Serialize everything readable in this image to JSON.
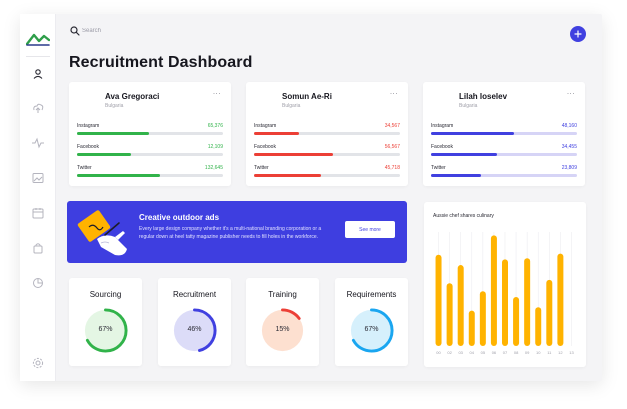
{
  "search": {
    "placeholder": "Search"
  },
  "page": {
    "title": "Recruitment Dashboard"
  },
  "colors": {
    "accent": "#4040e0",
    "green": "#31b34a",
    "red": "#ec3f36",
    "purple": "#4040e0",
    "orange": "#ffb300",
    "logo_green": "#2e9e4a",
    "logo_blue": "#2a3a8c"
  },
  "sidebar": {
    "logo": "brand-logo",
    "items": [
      {
        "icon": "user-icon",
        "active": true
      },
      {
        "icon": "upload-icon",
        "active": false
      },
      {
        "icon": "activity-icon",
        "active": false
      },
      {
        "icon": "image-icon",
        "active": false
      },
      {
        "icon": "calendar-icon",
        "active": false
      },
      {
        "icon": "bag-icon",
        "active": false
      },
      {
        "icon": "pie-chart-icon",
        "active": false
      },
      {
        "icon": "settings-icon",
        "active": false
      }
    ]
  },
  "profiles": [
    {
      "name": "Ava Gregoraci",
      "location": "Bulgaria",
      "menu": "...",
      "color": "#31b34a",
      "track": "#e2e4e8",
      "stats": [
        {
          "label": "Instagram",
          "value": "65,376",
          "fraction": 0.49
        },
        {
          "label": "Facebook",
          "value": "12,109",
          "fraction": 0.37
        },
        {
          "label": "Twitter",
          "value": "132,645",
          "fraction": 0.57
        }
      ]
    },
    {
      "name": "Somun Ae-Ri",
      "location": "Bulgaria",
      "menu": "...",
      "color": "#ec3f36",
      "track": "#e2e4e8",
      "stats": [
        {
          "label": "Instagram",
          "value": "34,567",
          "fraction": 0.31
        },
        {
          "label": "Facebook",
          "value": "56,567",
          "fraction": 0.54
        },
        {
          "label": "Twitter",
          "value": "45,718",
          "fraction": 0.46
        }
      ]
    },
    {
      "name": "Lilah loselev",
      "location": "Bulgaria",
      "menu": "...",
      "color": "#4040e0",
      "track": "#d6d4f6",
      "stats": [
        {
          "label": "Instagram",
          "value": "48,160",
          "fraction": 0.57
        },
        {
          "label": "Facebook",
          "value": "34,455",
          "fraction": 0.45
        },
        {
          "label": "Twitter",
          "value": "23,809",
          "fraction": 0.34
        }
      ]
    }
  ],
  "banner": {
    "title": "Creative outdoor ads",
    "text": "Every large design company whether it's a multi-national branding corporation or a regular down at heel tatty magazine publisher needs to fill holes in the workforce.",
    "button_label": "See more",
    "background": "#3e3ee0"
  },
  "metrics": [
    {
      "title": "Sourcing",
      "value_label": "67%",
      "value": 0.67,
      "color": "#31b34a",
      "fill": "#e4f6e4"
    },
    {
      "title": "Recruitment",
      "value_label": "46%",
      "value": 0.46,
      "color": "#4040e0",
      "fill": "#dcdcf8"
    },
    {
      "title": "Training",
      "value_label": "15%",
      "value": 0.15,
      "color": "#ec3f36",
      "fill": "#fde0d0"
    },
    {
      "title": "Requirements",
      "value_label": "67%",
      "value": 0.67,
      "color": "#1aa6f0",
      "fill": "#d6f0fc"
    }
  ],
  "chart_data": {
    "type": "bar",
    "title": "Aussie chef shares culinary",
    "categories": [
      "00",
      "02",
      "03",
      "04",
      "05",
      "06",
      "07",
      "08",
      "09",
      "10",
      "11",
      "12",
      "13"
    ],
    "values": [
      0.8,
      0.55,
      0.71,
      0.31,
      0.48,
      0.97,
      0.76,
      0.43,
      0.77,
      0.34,
      0.58,
      0.81,
      0.0
    ],
    "ylim": [
      0,
      1
    ],
    "color": "#ffb300",
    "grid": true
  }
}
